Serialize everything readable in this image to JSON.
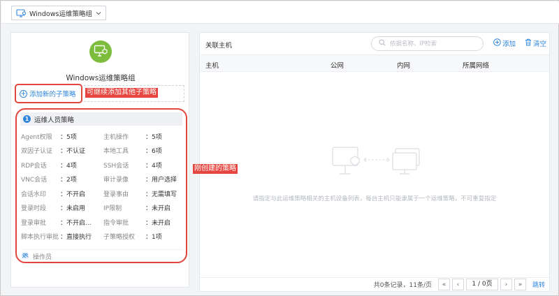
{
  "header": {
    "group_selector_label": "Windows运维策略组"
  },
  "left": {
    "group_name": "Windows运维策略组",
    "add_sub_policy_label": "添加新的子策略",
    "annotation_add": "可继续添加其他子策略",
    "annotation_policy": "刚创建的策略",
    "policy": {
      "index": "1",
      "title": "运维人员策略",
      "rows": [
        {
          "k1": "Agent权限",
          "v1": "：5项",
          "k2": "主机操作",
          "v2": "：5项"
        },
        {
          "k1": "双因子认证",
          "v1": "：不认证",
          "k2": "本地工具",
          "v2": "：6项"
        },
        {
          "k1": "RDP会话",
          "v1": "：4项",
          "k2": "SSH会话",
          "v2": "：4项"
        },
        {
          "k1": "VNC会话",
          "v1": "：2项",
          "k2": "审计录像",
          "v2": "：用户选择"
        },
        {
          "k1": "会话水印",
          "v1": "：不开启",
          "k2": "登录事由",
          "v2": "：无需填写"
        },
        {
          "k1": "登录时段",
          "v1": "：未启用",
          "k2": "IP限制",
          "v2": "：未开启"
        },
        {
          "k1": "登录审批",
          "v1": "：不开启...",
          "k2": "指令审批",
          "v2": "：未开启"
        },
        {
          "k1": "脚本执行审批",
          "v1": "：直接执行",
          "k2": "子策略授权",
          "v2": "：1项"
        }
      ],
      "operator_label": "操作员"
    }
  },
  "right": {
    "title": "关联主机",
    "search_placeholder": "依据名称、IP检索",
    "add_label": "添加",
    "clear_label": "清空",
    "columns": [
      "主机",
      "公网",
      "内网",
      "所属网络"
    ],
    "empty_text": "请指定与此运维策略相关的主机设备列表，每台主机只能隶属于一个运维策略，不可重复指定",
    "pager": {
      "total": "共0条记录，11条/页",
      "first": "«",
      "prev": "‹",
      "page": "1 / 0页",
      "next": "›",
      "last": "»",
      "jump": "跳转"
    }
  },
  "colors": {
    "accent": "#2f86de",
    "annotation": "#e3453e",
    "avatar": "#7cbd3d"
  }
}
